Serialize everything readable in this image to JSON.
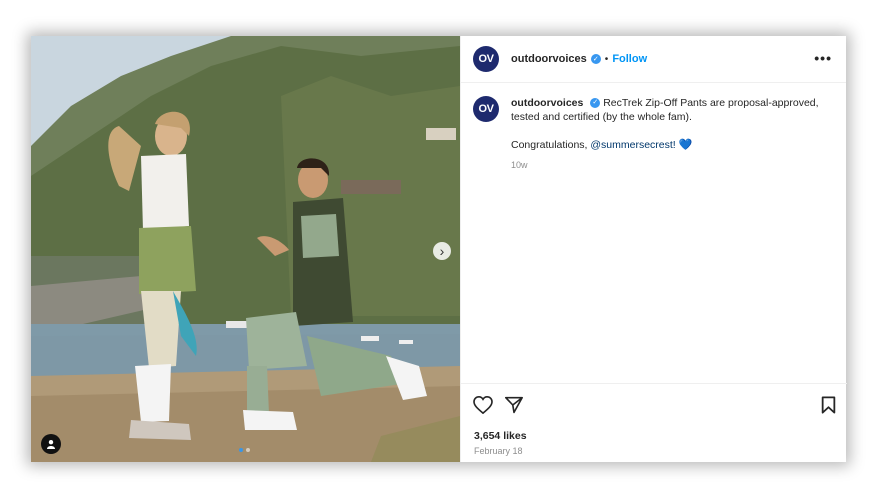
{
  "post": {
    "username": "outdoorvoices",
    "avatar_initials": "OV",
    "follow_label": "Follow",
    "separator": "•",
    "more_label": "•••",
    "caption_text": "RecTrek Zip-Off Pants are proposal-approved, tested and certified (by the whole fam).",
    "congrats_text": "Congratulations, ",
    "mention": "@summersecrest!",
    "emoji": "💙",
    "time_ago": "10w",
    "likes": "3,654 likes",
    "date": "February 18",
    "carousel_total": 2,
    "carousel_active": 1
  },
  "icons": {
    "verified": "verified-badge-icon",
    "like": "heart-icon",
    "share": "send-icon",
    "save": "bookmark-icon",
    "next": "chevron-right-icon",
    "user_tag": "user-tag-icon"
  },
  "colors": {
    "accent": "#0095f6",
    "avatar_bg": "#1e2a6e",
    "verified": "#3897f0"
  }
}
